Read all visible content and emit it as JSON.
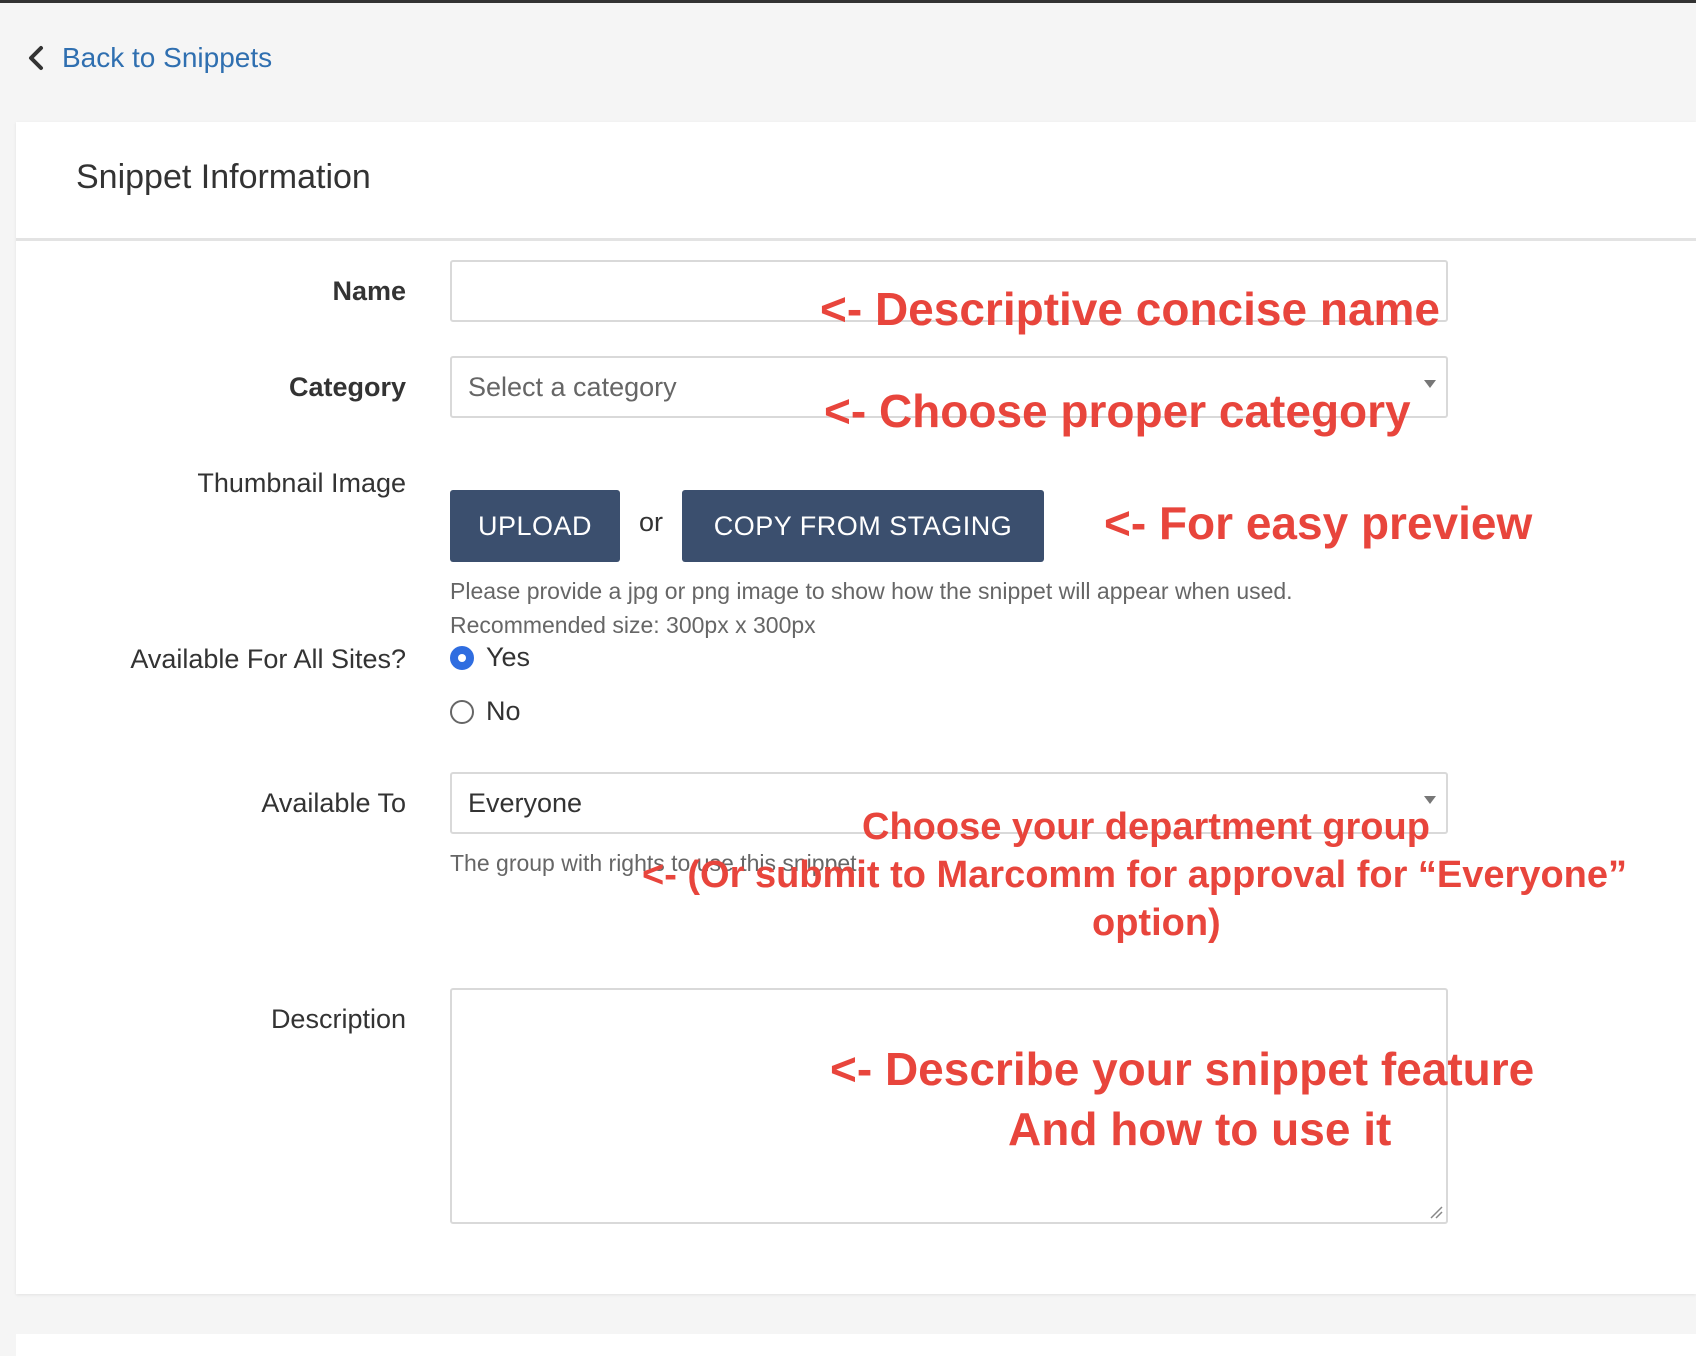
{
  "nav": {
    "back_label": "Back to Snippets"
  },
  "card": {
    "title": "Snippet Information"
  },
  "form": {
    "name": {
      "label": "Name",
      "value": ""
    },
    "category": {
      "label": "Category",
      "placeholder": "Select a category"
    },
    "thumbnail": {
      "label": "Thumbnail Image",
      "upload_label": "UPLOAD",
      "or_label": "or",
      "copy_label": "COPY FROM STAGING",
      "help_line1": "Please provide a jpg or png image to show how the snippet will appear when used.",
      "help_line2": "Recommended size: 300px x 300px"
    },
    "available_all_sites": {
      "label": "Available For All Sites?",
      "options": [
        "Yes",
        "No"
      ],
      "selected": "Yes"
    },
    "available_to": {
      "label": "Available To",
      "value": "Everyone",
      "help": "The group with rights to use this snippet."
    },
    "description": {
      "label": "Description",
      "value": ""
    }
  },
  "annotations": {
    "name": "<- Descriptive concise name",
    "category": "<- Choose proper category",
    "thumbnail": "<- For easy preview",
    "group_line1": "Choose your department group",
    "group_line2": "<- (Or submit to Marcomm for approval for “Everyone”",
    "group_line3": "option)",
    "description_line1": "<- Describe your snippet feature",
    "description_line2": "And how to use it"
  },
  "colors": {
    "link": "#2f6fb0",
    "button": "#3b4f6e",
    "annotation": "#e8453c",
    "radio_selected": "#2f6de0"
  },
  "icons": {
    "back": "chevron-left-icon",
    "select_caret": "caret-down-icon",
    "resize": "resize-grip-icon"
  }
}
